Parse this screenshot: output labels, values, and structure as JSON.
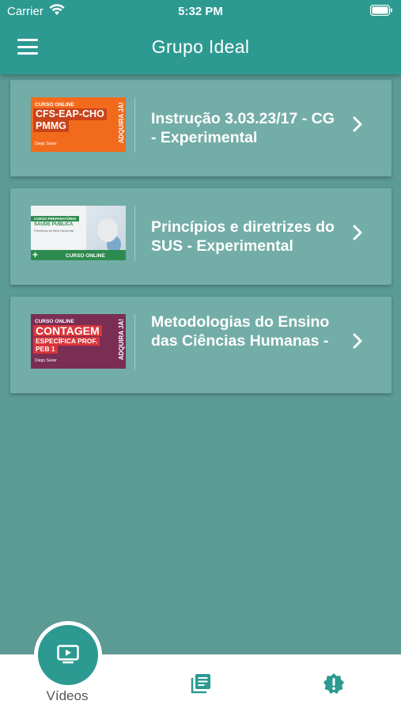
{
  "status_bar": {
    "carrier": "Carrier",
    "time": "5:32 PM"
  },
  "header": {
    "title": "Grupo Ideal"
  },
  "courses": [
    {
      "title": "Instrução 3.03.23/17 - CG - Experimental",
      "thumbnail": {
        "top_label": "CURSO ONLINE",
        "line1": "CFS-EAP-CHO",
        "line2": "PMMG",
        "side": "ADQUIRA JÁ!",
        "logo": "Diego Saner"
      }
    },
    {
      "title": "Princípios e diretrizes do SUS - Experimental",
      "thumbnail": {
        "tag": "CURSO PREPARATÓRIO",
        "line1": "SAÚDE PÚBLICA",
        "line2": "Prefeitura de Belo Horizonte",
        "bottom": "CURSO ONLINE"
      }
    },
    {
      "title": "Metodologias do Ensino das Ciências Humanas -",
      "thumbnail": {
        "top_label": "CURSO ONLINE",
        "line1": "CONTAGEM",
        "line2": "ESPECÍFICA PROF.",
        "line3": "PEB 1",
        "side": "ADQUIRA JÁ!",
        "logo": "Diego Saner"
      }
    }
  ],
  "tabs": [
    {
      "label": "Vídeos",
      "icon": "video-icon",
      "active": true
    },
    {
      "label": "",
      "icon": "document-icon",
      "active": false
    },
    {
      "label": "",
      "icon": "alert-badge-icon",
      "active": false
    }
  ],
  "colors": {
    "accent": "#2c9a91",
    "background": "#5c9a94",
    "card": "#73ada7"
  }
}
